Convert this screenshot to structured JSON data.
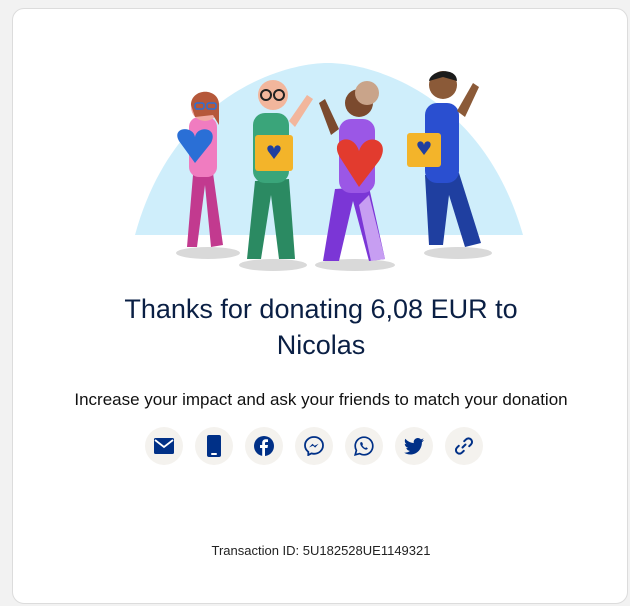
{
  "colors": {
    "accent": "#003087",
    "backdrop": "#cfeefb",
    "icon_bg": "#f4f2ee"
  },
  "illustration": {
    "icon": "donation-friends-illustration"
  },
  "thanks": {
    "line1": "Thanks for donating 6,08 EUR to",
    "line2": "Nicolas"
  },
  "share": {
    "prompt": "Increase your impact and ask your friends to match your donation",
    "buttons": [
      {
        "icon": "email-icon"
      },
      {
        "icon": "sms-icon"
      },
      {
        "icon": "facebook-icon"
      },
      {
        "icon": "messenger-icon"
      },
      {
        "icon": "whatsapp-icon"
      },
      {
        "icon": "twitter-icon"
      },
      {
        "icon": "link-icon"
      }
    ]
  },
  "transaction": {
    "text": "Transaction ID: 5U182528UE1149321"
  }
}
